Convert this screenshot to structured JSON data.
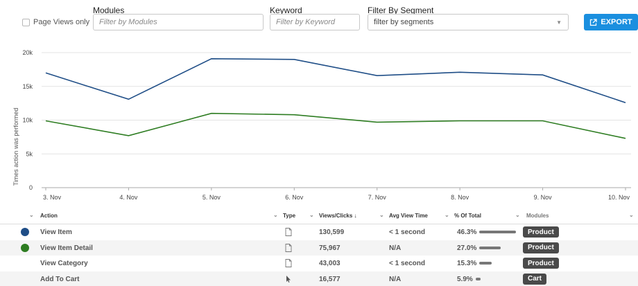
{
  "filters": {
    "page_views_only_label": "Page Views only",
    "page_views_only_checked": false,
    "modules_label": "Modules",
    "modules_placeholder": "Filter by Modules",
    "keyword_label": "Keyword",
    "keyword_placeholder": "Filter by Keyword",
    "segment_label": "Filter By Segment",
    "segment_value": "filter by segments",
    "export_label": "EXPORT"
  },
  "colors": {
    "series_blue": "#1f4e87",
    "series_green": "#2e7d22",
    "export_bg": "#1a8fdf",
    "badge_bg": "#4a4a4a"
  },
  "chart_data": {
    "type": "line",
    "ylabel": "Times action was performed",
    "x": [
      "3. Nov",
      "4. Nov",
      "5. Nov",
      "6. Nov",
      "7. Nov",
      "8. Nov",
      "9. Nov",
      "10. Nov"
    ],
    "y_ticks": [
      "0",
      "5k",
      "10k",
      "15k",
      "20k"
    ],
    "ylim": [
      0,
      20000
    ],
    "grid": true,
    "series": [
      {
        "values": [
          17000,
          13100,
          19100,
          19000,
          16600,
          17100,
          16700,
          12600
        ],
        "color": "#1f4e87"
      },
      {
        "values": [
          9900,
          7700,
          11000,
          10800,
          9700,
          9900,
          9900,
          7300
        ],
        "color": "#2e7d22"
      }
    ]
  },
  "table": {
    "headers": {
      "action": "Action",
      "type": "Type",
      "views": "Views/Clicks ↓",
      "avg_time": "Avg View Time",
      "pct": "% Of Total",
      "modules": "Modules"
    },
    "rows": [
      {
        "dot_color": "#1f4e87",
        "action": "View Item",
        "type_icon": "page-icon",
        "views": "130,599",
        "avg_time": "< 1 second",
        "pct": "46.3%",
        "pct_value": 46.3,
        "module": "Product"
      },
      {
        "dot_color": "#2e7d22",
        "action": "View Item Detail",
        "type_icon": "page-icon",
        "views": "75,967",
        "avg_time": "N/A",
        "pct": "27.0%",
        "pct_value": 27.0,
        "module": "Product"
      },
      {
        "dot_color": "",
        "action": "View Category",
        "type_icon": "page-icon",
        "views": "43,003",
        "avg_time": "< 1 second",
        "pct": "15.3%",
        "pct_value": 15.3,
        "module": "Product"
      },
      {
        "dot_color": "",
        "action": "Add To Cart",
        "type_icon": "cursor-icon",
        "views": "16,577",
        "avg_time": "N/A",
        "pct": "5.9%",
        "pct_value": 5.9,
        "module": "Cart"
      }
    ]
  }
}
